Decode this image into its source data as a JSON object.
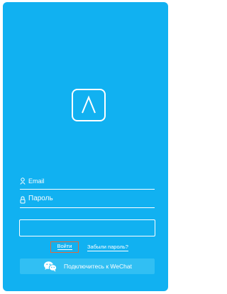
{
  "login": {
    "email_placeholder": "Email",
    "password_placeholder": "Пароль",
    "login_label": "Войти",
    "forgot_label": "Забыли пароль?",
    "wechat_label": "Подключитесь к WeChat"
  },
  "icons": {
    "logo": "lambda-logo-icon",
    "email": "user-icon",
    "password": "lock-icon",
    "wechat": "wechat-icon"
  },
  "colors": {
    "background": "#11b1f1",
    "wechat_button": "#31bff3",
    "login_highlight": "#e06a3b",
    "text": "#ffffff"
  }
}
